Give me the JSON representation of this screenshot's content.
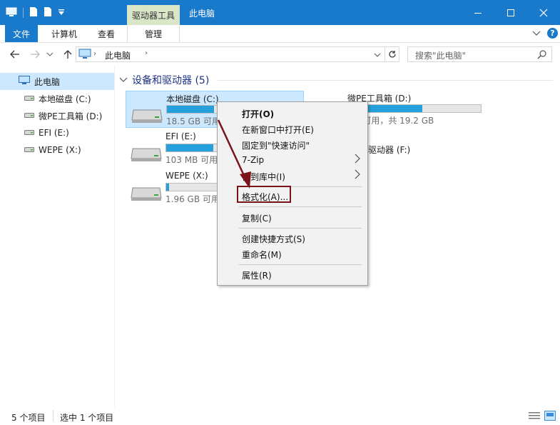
{
  "titlebar": {
    "context_tab": "驱动器工具",
    "title": "此电脑",
    "minimize_icon": "minimize-icon",
    "maximize_icon": "maximize-icon",
    "close_icon": "close-icon",
    "background": "#1979ca"
  },
  "ribbon": {
    "tabs": [
      "文件",
      "计算机",
      "查看",
      "管理"
    ],
    "help_icon": "help-icon"
  },
  "address": {
    "path_item": "此电脑",
    "search_placeholder": "搜索\"此电脑\""
  },
  "nav": {
    "items": [
      {
        "label": "此电脑",
        "icon": "this-pc-icon",
        "selected": true
      },
      {
        "label": "本地磁盘 (C:)",
        "icon": "drive-icon"
      },
      {
        "label": "微PE工具箱 (D:)",
        "icon": "drive-icon"
      },
      {
        "label": "EFI (E:)",
        "icon": "drive-icon"
      },
      {
        "label": "WEPE (X:)",
        "icon": "drive-icon"
      }
    ]
  },
  "content": {
    "group_header": "设备和驱动器 (5)",
    "drives": [
      {
        "name": "本地磁盘 (C:)",
        "capacity": "18.5 GB 可用",
        "used_fraction": 0.35
      },
      {
        "name": "EFI (E:)",
        "capacity": "103 MB 可用",
        "used_fraction": 0.35
      },
      {
        "name": "WEPE (X:)",
        "capacity": "1.96 GB 可用",
        "used_fraction": 0.02
      },
      {
        "name": "微PE工具箱 (D:)",
        "capacity": "GB 可用，共 19.2 GB",
        "used_fraction": 0.56
      },
      {
        "name": "驱动器 (F:)"
      }
    ]
  },
  "context_menu": {
    "items": [
      "打开(O)",
      "在新窗口中打开(E)",
      "固定到\"快速访问\"",
      "7-Zip",
      "含到库中(I)",
      "格式化(A)...",
      "复制(C)",
      "创建快捷方式(S)",
      "重命名(M)",
      "属性(R)"
    ],
    "highlight_color": "#7b1418"
  },
  "statusbar": {
    "item_count": "5 个项目",
    "selected_count": "选中 1 个项目"
  }
}
